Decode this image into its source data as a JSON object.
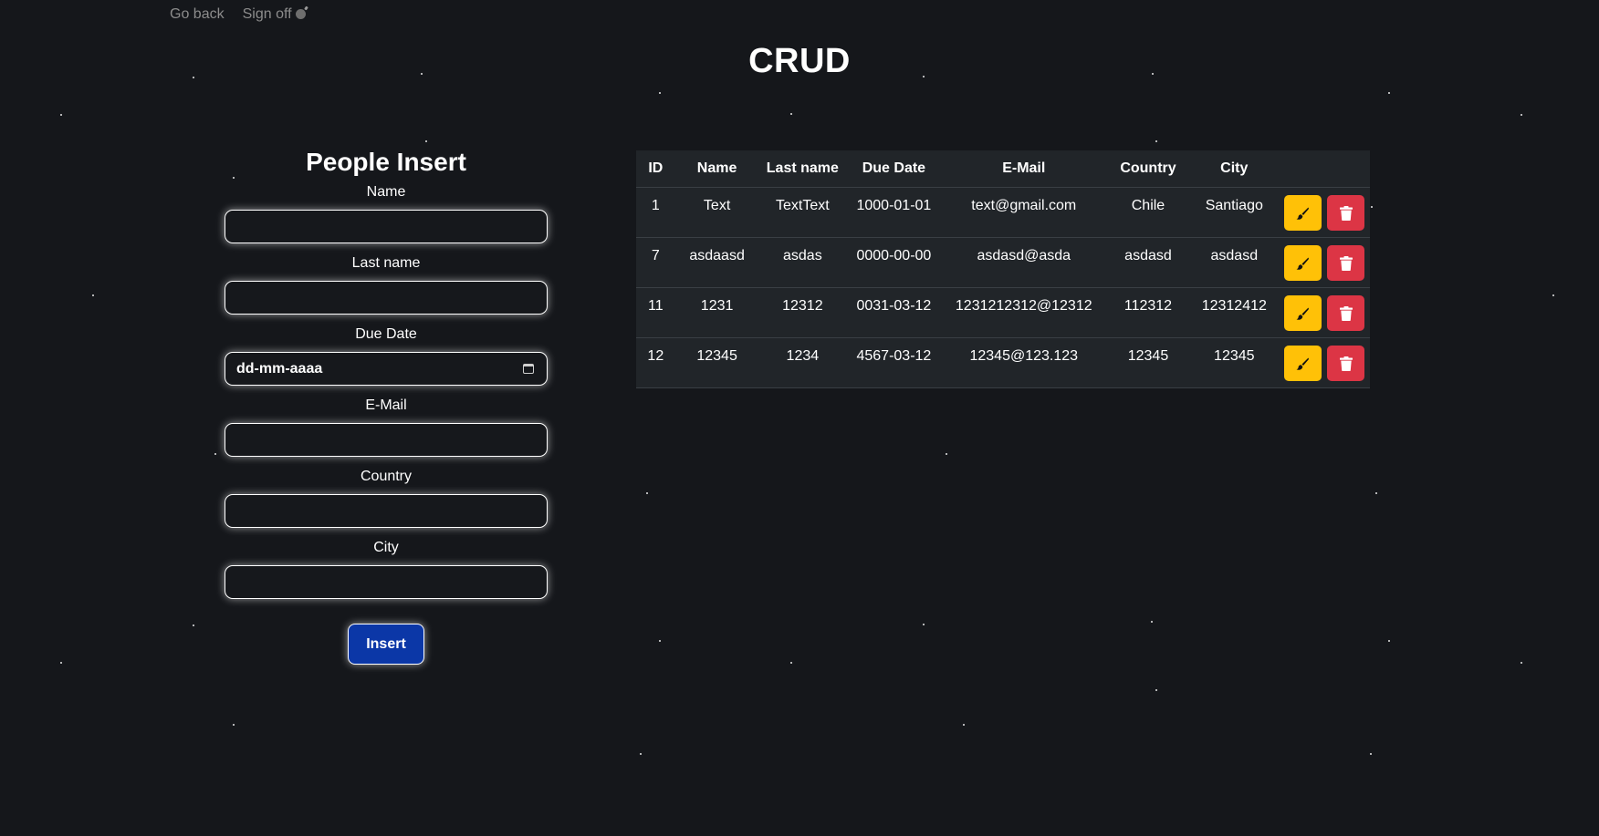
{
  "nav": {
    "go_back": "Go back",
    "sign_off": "Sign off"
  },
  "page_title": "CRUD",
  "form": {
    "title": "People Insert",
    "fields": {
      "name": {
        "label": "Name",
        "value": ""
      },
      "last_name": {
        "label": "Last name",
        "value": ""
      },
      "due_date": {
        "label": "Due Date",
        "placeholder": "dd-mm-aaaa"
      },
      "email": {
        "label": "E-Mail",
        "value": ""
      },
      "country": {
        "label": "Country",
        "value": ""
      },
      "city": {
        "label": "City",
        "value": ""
      }
    },
    "submit_label": "Insert"
  },
  "table": {
    "headers": [
      "ID",
      "Name",
      "Last name",
      "Due Date",
      "E-Mail",
      "Country",
      "City",
      ""
    ],
    "rows": [
      {
        "id": "1",
        "name": "Text",
        "last_name": "TextText",
        "due_date": "1000-01-01",
        "email": "text@gmail.com",
        "country": "Chile",
        "city": "Santiago"
      },
      {
        "id": "7",
        "name": "asdaasd",
        "last_name": "asdas",
        "due_date": "0000-00-00",
        "email": "asdasd@asda",
        "country": "asdasd",
        "city": "asdasd"
      },
      {
        "id": "11",
        "name": "1231",
        "last_name": "12312",
        "due_date": "0031-03-12",
        "email": "1231212312@12312",
        "country": "112312",
        "city": "12312412"
      },
      {
        "id": "12",
        "name": "12345",
        "last_name": "1234",
        "due_date": "4567-03-12",
        "email": "12345@123.123",
        "country": "12345",
        "city": "12345"
      }
    ],
    "row_actions": {
      "edit_icon": "brush-icon",
      "delete_icon": "trash-icon"
    }
  },
  "colors": {
    "background": "#15171b",
    "table_bg": "#212529",
    "edit_button": "#ffc107",
    "delete_button": "#dc3545",
    "insert_button": "#0b37a7"
  }
}
